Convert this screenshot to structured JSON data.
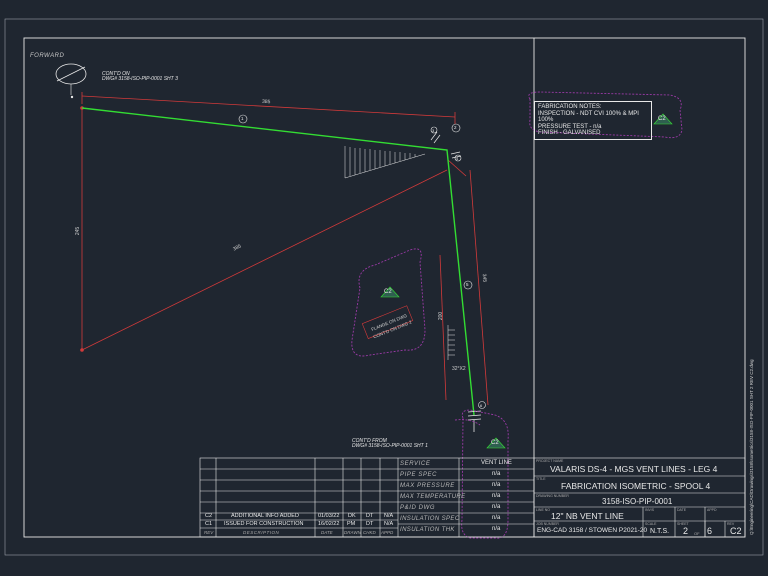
{
  "drawing": {
    "forward_label": "FORWARD",
    "cont_on_top": "CONT'D ON",
    "cont_on_top_ref": "DWG# 3158-ISO-PIP-0001 SHT 3",
    "cont_from_bottom": "CONT'D FROM",
    "cont_from_bottom_ref": "DWG# 3158-ISO-PIP-0001 SHT 1",
    "dim_top": "385",
    "dim_left": "245",
    "dim_diag": "385",
    "dim_right": "345",
    "dim_small": "200",
    "angle_label": "32°X2",
    "weld_ids": [
      "1",
      "2",
      "3",
      "4",
      "5",
      "6"
    ],
    "stamp_text_1": "FLANGE ON DWG",
    "stamp_text_2": "CONT'D ON DWG 2",
    "rev_cloud_label": "C2",
    "side_text": "Q:\\Engineering\\CAD\\Drawings\\3158\\Isometrics\\3158-ISO-PIP-0001 SHT 2 REV C2.dwg"
  },
  "fabrication_notes": {
    "title": "FABRICATION NOTES:",
    "line1": "INSPECTION - NDT CVI 100% & MPI 100%",
    "line2": "PRESSURE TEST - n/a",
    "line3": "FINISH - GALVANISED",
    "rev_tag": "C2"
  },
  "title_block": {
    "revisions": [
      {
        "rev": "C2",
        "description": "ADDITIONAL INFO ADDED",
        "date": "01/03/22",
        "drawn": "DK",
        "chkd": "DT",
        "appd": "N/A"
      },
      {
        "rev": "C1",
        "description": "ISSUED FOR CONSTRUCTION",
        "date": "16/02/22",
        "drawn": "PM",
        "chkd": "DT",
        "appd": "N/A"
      }
    ],
    "rev_headers": {
      "rev": "REV",
      "description": "DESCRIPTION",
      "date": "DATE",
      "drawn": "DRAWN",
      "chkd": "CHKD",
      "appd": "APPD"
    },
    "specs": [
      {
        "label": "SERVICE",
        "value": "VENT LINE"
      },
      {
        "label": "PIPE SPEC",
        "value": "n/a"
      },
      {
        "label": "MAX PRESSURE",
        "value": "n/a"
      },
      {
        "label": "MAX TEMPERATURE",
        "value": "n/a"
      },
      {
        "label": "P&ID DWG",
        "value": "n/a"
      },
      {
        "label": "INSULATION SPEC",
        "value": "n/a"
      },
      {
        "label": "INSULATION THK",
        "value": "n/a"
      }
    ],
    "project_title_label": "PROJECT NAME",
    "project_title": "VALARIS DS-4 - MGS VENT LINES - LEG 4",
    "title_label": "TITLE",
    "title": "FABRICATION ISOMETRIC - SPOOL 4",
    "drawing_number_label": "DRAWING NUMBER",
    "drawing_number": "3158-ISO-PIP-0001",
    "line_no_label": "LINE NO",
    "line_no": "12\" NB VENT LINE",
    "job_number_label": "JOB NUMBER",
    "job_number": "ENG-CAD 3158 / STOWEN P2021-20",
    "scale_label": "SCALE",
    "scale": "N.T.S.",
    "sheet_label": "SHEET",
    "sheet": "2",
    "of_label": "OF",
    "of": "6",
    "rev_label": "REV",
    "rev": "C2",
    "inv_label": "INV/S",
    "date_label": "DATE",
    "appd_label": "APPD"
  },
  "colors": {
    "background": "#1f2630",
    "border": "#e8e8e8",
    "pipe": "#33dd33",
    "dim": "#d23a3a",
    "cloud": "#9a3aa6",
    "tag_fill": "#2f5f4f"
  }
}
